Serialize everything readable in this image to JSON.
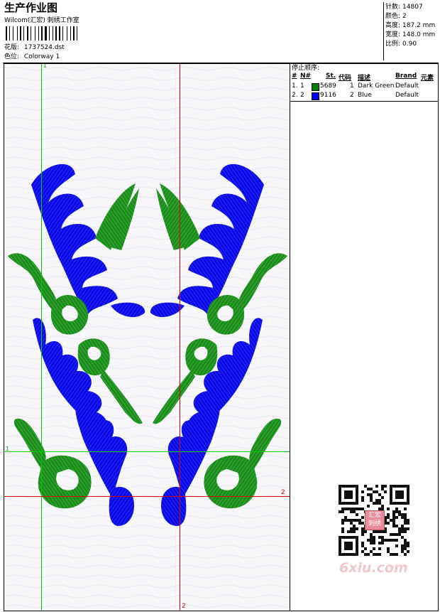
{
  "header": {
    "title": "生产作业图",
    "subtitle": "Wilcom(汇宏) 刺绣工作室",
    "design_label": "花版:",
    "design_value": "1737524.dst",
    "colorway_label": "色位:",
    "colorway_value": "Colorway 1"
  },
  "stats": [
    {
      "label": "针数:",
      "value": "14807"
    },
    {
      "label": "颜色:",
      "value": "2"
    },
    {
      "label": "高度:",
      "value": "187.2 mm"
    },
    {
      "label": "宽度:",
      "value": "148.0 mm"
    },
    {
      "label": "比例:",
      "value": "0.90"
    }
  ],
  "stop_sequence": {
    "title": "停止顺序:",
    "columns": [
      "#",
      "N#",
      "St.",
      "代码",
      "描述",
      "Brand",
      "元素"
    ],
    "rows": [
      {
        "idx": "1.",
        "n": "1",
        "stitches": "5689",
        "code": "1",
        "desc": "Dark Green",
        "brand": "Default",
        "color": "#008000"
      },
      {
        "idx": "2.",
        "n": "2",
        "stitches": "9116",
        "code": "2",
        "desc": "Blue",
        "brand": "Default",
        "color": "#0000ff"
      }
    ]
  },
  "guides": {
    "v_green_label": "1",
    "h_green_label": "1",
    "h_red_label": "2",
    "v_red_label": "2"
  },
  "colors": {
    "green": "#1a8c1a",
    "blue": "#0a0ae6",
    "guide_green": "#00cc00",
    "guide_red": "#e00000"
  },
  "watermark": {
    "text": "6xiu.com",
    "qr_badge": "汇宏刺绣"
  }
}
